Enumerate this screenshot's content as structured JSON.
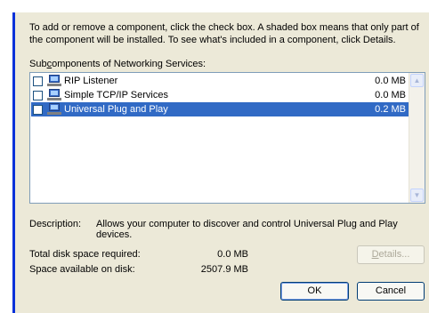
{
  "intro_text": "To add or remove a component, click the check box. A shaded box means that only part of the component will be installed. To see what's included in a component, click Details.",
  "subcomponents_label": {
    "prefix": "Sub",
    "accel": "c",
    "suffix": "omponents of Networking Services:"
  },
  "components": [
    {
      "label": "RIP Listener",
      "size": "0.0 MB",
      "checked": false,
      "selected": false
    },
    {
      "label": "Simple TCP/IP Services",
      "size": "0.0 MB",
      "checked": false,
      "selected": false
    },
    {
      "label": "Universal Plug and Play",
      "size": "0.2 MB",
      "checked": false,
      "selected": true
    }
  ],
  "description": {
    "label": "Description:",
    "text": "Allows your computer to discover and control Universal Plug and Play devices."
  },
  "disk": {
    "required_label": "Total disk space required:",
    "required_value": "0.0 MB",
    "available_label": "Space available on disk:",
    "available_value": "2507.9 MB"
  },
  "buttons": {
    "details": {
      "accel": "D",
      "rest": "etails..."
    },
    "ok": "OK",
    "cancel": "Cancel"
  },
  "colors": {
    "selection": "#316ac5",
    "dialog_bg": "#ece9d8",
    "window_border": "#0831d9"
  }
}
